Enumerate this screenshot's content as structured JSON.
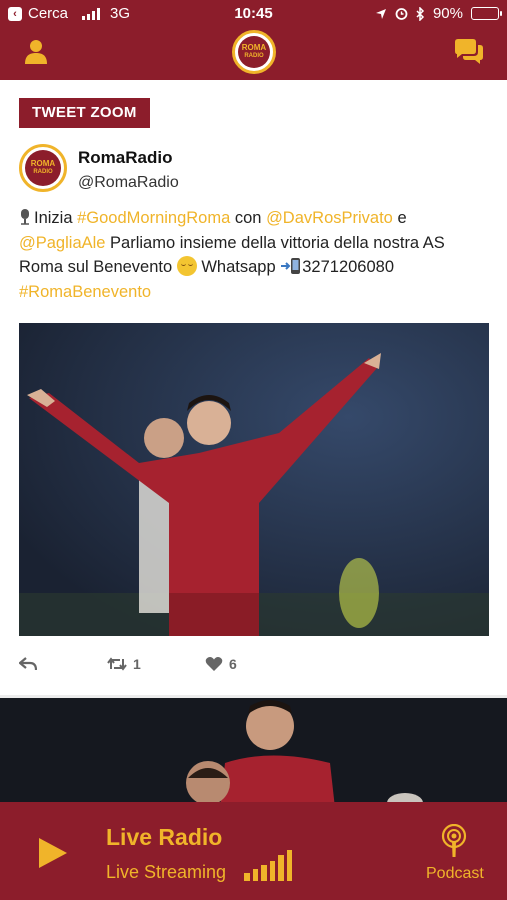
{
  "status_bar": {
    "back_label": "Cerca",
    "network": "3G",
    "time": "10:45",
    "battery": "90%",
    "battery_level": 0.9
  },
  "nav": {
    "logo_line1": "ROMA",
    "logo_line2": "RADIO"
  },
  "tweet": {
    "badge": "TWEET ZOOM",
    "author_name": "RomaRadio",
    "author_handle": "@RomaRadio",
    "text_parts": {
      "p1": "Inizia ",
      "hashtag1": "#GoodMorningRoma",
      "p2": " con ",
      "mention1": "@DavRosPrivato",
      "p3": " e ",
      "mention2": "@PagliaAle",
      "p4": " Parliamo insieme della vittoria della nostra AS Roma sul Benevento ",
      "p5": " Whatsapp ",
      "phone": "3271206080",
      "hashtag2": "#RomaBenevento"
    },
    "retweets": "1",
    "likes": "6"
  },
  "player": {
    "title": "Live Radio",
    "subtitle": "Live Streaming",
    "podcast_label": "Podcast"
  },
  "colors": {
    "brand_red": "#8c1d2b",
    "brand_gold": "#f0b42a"
  },
  "icons": [
    "back-icon",
    "signal-bars-icon",
    "location-icon",
    "alarm-icon",
    "bluetooth-icon",
    "battery-icon",
    "user-icon",
    "chat-icon",
    "microphone-icon",
    "relieved-face-icon",
    "phone-arrow-icon",
    "reply-icon",
    "retweet-icon",
    "heart-icon",
    "play-icon",
    "audio-level-icon",
    "podcast-icon"
  ]
}
